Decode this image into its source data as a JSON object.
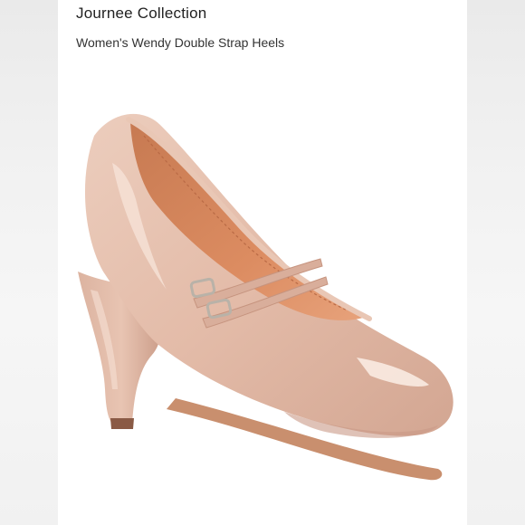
{
  "listing": {
    "brand": "Journee Collection",
    "title": "Women's Wendy Double Strap Heels"
  },
  "product_image": {
    "icon": "nude-patent-mary-jane-pump",
    "colors": {
      "patent": "#e5bfae",
      "patent_shadow": "#c99a87",
      "lining": "#d9875e",
      "sole": "#c98f6e",
      "buckle": "#b9b2a8"
    }
  }
}
